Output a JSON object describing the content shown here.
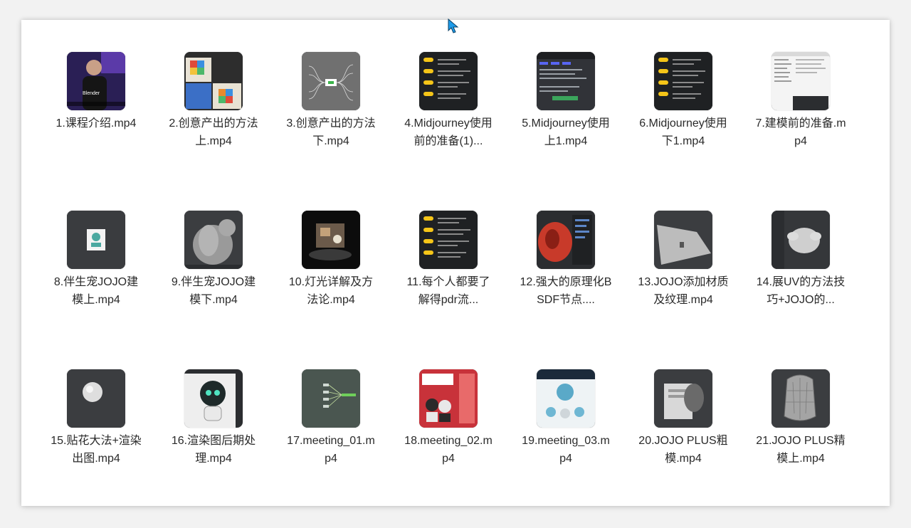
{
  "files": [
    {
      "name": "1.课程介绍.mp4",
      "thumb": "talking-head-video-thumbnail"
    },
    {
      "name": "2.创意产出的方法上.mp4",
      "thumb": "rubiks-cube-art-thumbnail"
    },
    {
      "name": "3.创意产出的方法下.mp4",
      "thumb": "mindmap-thumbnail"
    },
    {
      "name": "4.Midjourney使用前的准备(1)...",
      "thumb": "dark-outline-thumbnail"
    },
    {
      "name": "5.Midjourney使用上1.mp4",
      "thumb": "discord-ui-thumbnail"
    },
    {
      "name": "6.Midjourney使用下1.mp4",
      "thumb": "dark-outline-thumbnail"
    },
    {
      "name": "7.建模前的准备.mp4",
      "thumb": "settings-window-thumbnail"
    },
    {
      "name": "8.伴生宠JOJO建模上.mp4",
      "thumb": "sticker-on-dark-thumbnail"
    },
    {
      "name": "9.伴生宠JOJO建模下.mp4",
      "thumb": "3d-model-grey-thumbnail"
    },
    {
      "name": "10.灯光详解及方法论.mp4",
      "thumb": "lit-scene-thumbnail"
    },
    {
      "name": "11.每个人都要了解得pdr流...",
      "thumb": "dark-outline-thumbnail"
    },
    {
      "name": "12.强大的原理化BSDF节点....",
      "thumb": "red-material-thumbnail"
    },
    {
      "name": "13.JOJO添加材质及纹理.mp4",
      "thumb": "3d-viewport-thumbnail"
    },
    {
      "name": "14.展UV的方法技巧+JOJO的...",
      "thumb": "3d-head-model-thumbnail"
    },
    {
      "name": "15.贴花大法+渲染出图.mp4",
      "thumb": "sphere-model-thumbnail"
    },
    {
      "name": "16.渲染图后期处理.mp4",
      "thumb": "robot-render-thumbnail"
    },
    {
      "name": "17.meeting_01.mp4",
      "thumb": "green-diagram-thumbnail"
    },
    {
      "name": "18.meeting_02.mp4",
      "thumb": "ip-poster-thumbnail"
    },
    {
      "name": "19.meeting_03.mp4",
      "thumb": "robot-poster-thumbnail"
    },
    {
      "name": "20.JOJO PLUS粗模.mp4",
      "thumb": "rough-model-thumbnail"
    },
    {
      "name": "21.JOJO PLUS精模上.mp4",
      "thumb": "fine-model-thumbnail"
    }
  ],
  "colors": {
    "window_bg": "#ffffff",
    "label_text": "#2a2a2a",
    "cursor": "#1e9be9",
    "dark_ui": "#2b2d30",
    "accent_yellow": "#f5c518"
  }
}
